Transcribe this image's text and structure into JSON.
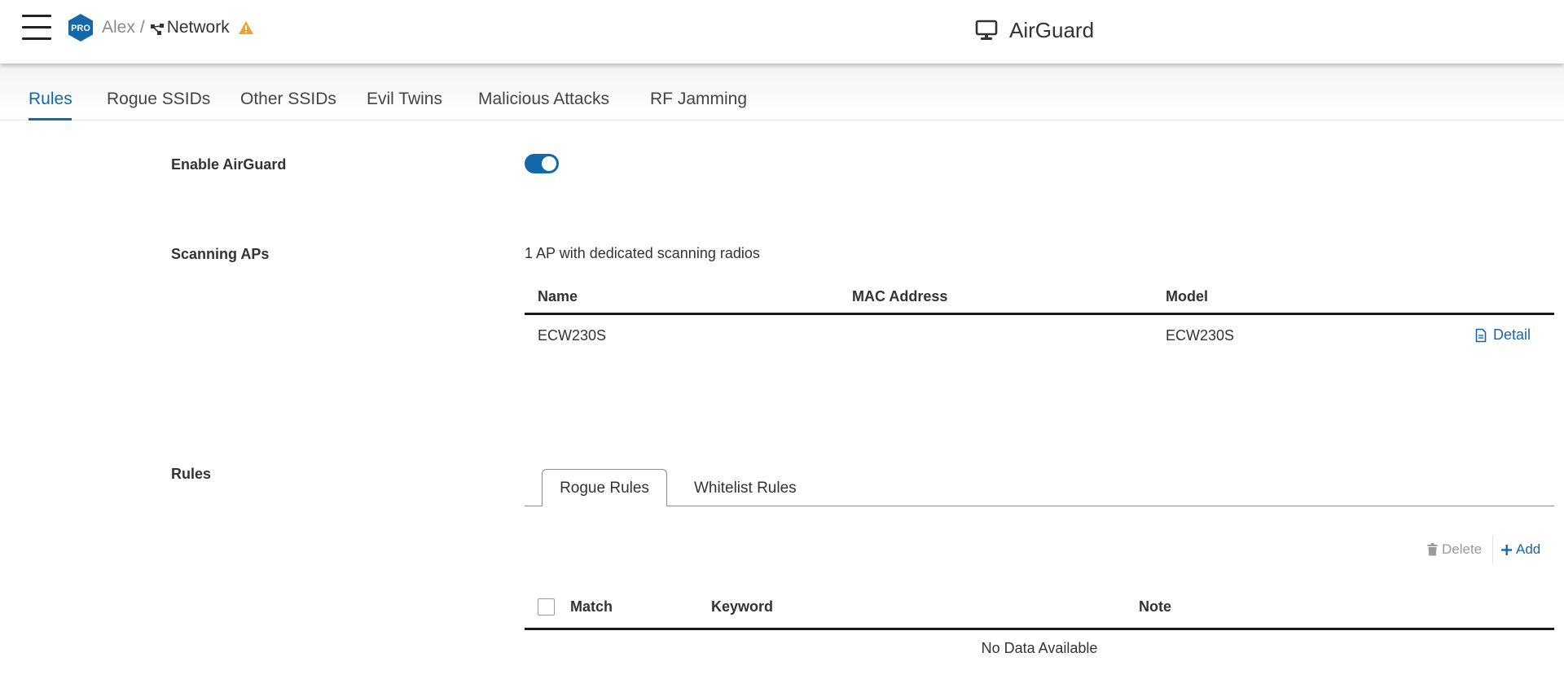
{
  "header": {
    "badge": "PRO",
    "breadcrumb": {
      "org": "Alex",
      "separator": "/",
      "network": "Network"
    },
    "app_title": "AirGuard"
  },
  "tabs": [
    {
      "label": "Rules",
      "active": true
    },
    {
      "label": "Rogue SSIDs",
      "active": false
    },
    {
      "label": "Other SSIDs",
      "active": false
    },
    {
      "label": "Evil Twins",
      "active": false
    },
    {
      "label": "Malicious Attacks",
      "active": false
    },
    {
      "label": "RF Jamming",
      "active": false
    }
  ],
  "enable": {
    "label": "Enable AirGuard",
    "enabled": true
  },
  "scanning": {
    "label": "Scanning APs",
    "description": "1 AP with dedicated scanning radios",
    "columns": [
      "Name",
      "MAC Address",
      "Model"
    ],
    "rows": [
      {
        "name": "ECW230S",
        "mac": "",
        "model": "ECW230S",
        "action": "Detail"
      }
    ]
  },
  "rules": {
    "label": "Rules",
    "subtabs": [
      {
        "label": "Rogue Rules",
        "active": true
      },
      {
        "label": "Whitelist Rules",
        "active": false
      }
    ],
    "actions": {
      "delete": "Delete",
      "add": "Add"
    },
    "columns": [
      "Match",
      "Keyword",
      "Note"
    ],
    "empty": "No Data Available"
  },
  "colors": {
    "accent": "#1467a8",
    "warning": "#f0a030",
    "badge": "#1467a8"
  },
  "icons": [
    "hamburger-icon",
    "pro-badge-icon",
    "network-topology-icon",
    "warning-icon",
    "monitor-icon",
    "document-icon",
    "trash-icon",
    "plus-icon"
  ]
}
